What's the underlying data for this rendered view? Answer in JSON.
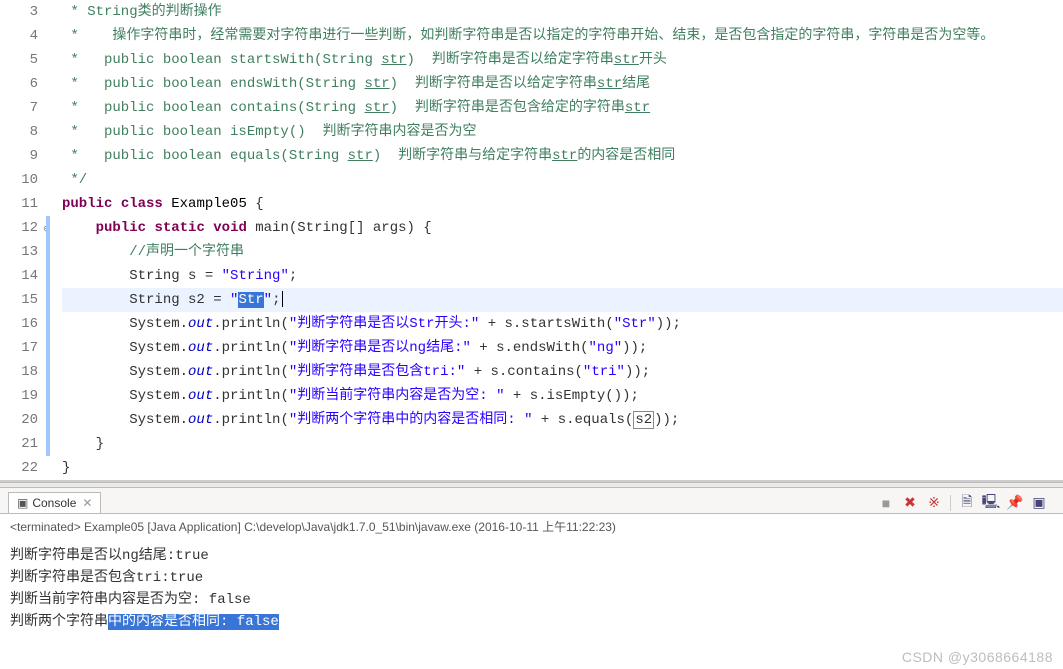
{
  "editor": {
    "lines": [
      {
        "n": 3,
        "html": "<span class='c-comment'> * String类的判断操作</span>"
      },
      {
        "n": 4,
        "html": "<span class='c-comment'> *    操作字符串时，经常需要对字符串进行一些判断，如判断字符串是否以指定的字符串开始、结束，是否包含指定的字符串，字符串是否为空等。</span>"
      },
      {
        "n": 5,
        "html": "<span class='c-comment'> *   public boolean startsWith(String </span><span class='c-underline'>str</span><span class='c-comment'>)  判断字符串是否以给定字符串</span><span class='c-underline'>str</span><span class='c-comment'>开头</span>"
      },
      {
        "n": 6,
        "html": "<span class='c-comment'> *   public boolean endsWith(String </span><span class='c-underline'>str</span><span class='c-comment'>)  判断字符串是否以给定字符串</span><span class='c-underline'>str</span><span class='c-comment'>结尾</span>"
      },
      {
        "n": 7,
        "html": "<span class='c-comment'> *   public boolean contains(String </span><span class='c-underline'>str</span><span class='c-comment'>)  判断字符串是否包含给定的字符串</span><span class='c-underline'>str</span>"
      },
      {
        "n": 8,
        "html": "<span class='c-comment'> *   public boolean isEmpty()  判断字符串内容是否为空</span>"
      },
      {
        "n": 9,
        "html": "<span class='c-comment'> *   public boolean equals(String </span><span class='c-underline'>str</span><span class='c-comment'>)  判断字符串与给定字符串</span><span class='c-underline'>str</span><span class='c-comment'>的内容是否相同</span>"
      },
      {
        "n": 10,
        "html": "<span class='c-comment'> */</span>"
      },
      {
        "n": 11,
        "html": "<span class='c-keyword'>public</span> <span class='c-keyword'>class</span> <span class='c-type'>Example05</span> {"
      },
      {
        "n": 12,
        "html": "    <span class='c-keyword'>public</span> <span class='c-keyword'>static</span> <span class='c-keyword'>void</span> main(String[] args) {",
        "mark": true,
        "bar": true
      },
      {
        "n": 13,
        "html": "        <span class='c-comment'>//声明一个字符串</span>",
        "bar": true
      },
      {
        "n": 14,
        "html": "        String s = <span class='c-string'>\"String\"</span>;",
        "bar": true
      },
      {
        "n": 15,
        "html": "        String s2 = <span class='c-string'>\"</span><span class='sel'><span class='c-string'>Str</span></span><span class='c-string'>\"</span>;<span class='caret' data-name='text-caret' data-interactable='false'></span>",
        "current": true,
        "bar": true
      },
      {
        "n": 16,
        "html": "        System.<span class='c-field'>out</span>.println(<span class='c-string'>\"判断字符串是否以Str开头:\"</span> + s.startsWith(<span class='c-string'>\"Str\"</span>));",
        "bar": true
      },
      {
        "n": 17,
        "html": "        System.<span class='c-field'>out</span>.println(<span class='c-string'>\"判断字符串是否以ng结尾:\"</span> + s.endsWith(<span class='c-string'>\"ng\"</span>));",
        "bar": true
      },
      {
        "n": 18,
        "html": "        System.<span class='c-field'>out</span>.println(<span class='c-string'>\"判断字符串是否包含tri:\"</span> + s.contains(<span class='c-string'>\"tri\"</span>));",
        "bar": true
      },
      {
        "n": 19,
        "html": "        System.<span class='c-field'>out</span>.println(<span class='c-string'>\"判断当前字符串内容是否为空: \"</span> + s.isEmpty());",
        "bar": true
      },
      {
        "n": 20,
        "html": "        System.<span class='c-field'>out</span>.println(<span class='c-string'>\"判断两个字符串中的内容是否相同: \"</span> + s.equals(<span class='c-box'>s2</span>));",
        "bar": true
      },
      {
        "n": 21,
        "html": "    }",
        "bar": true
      },
      {
        "n": 22,
        "html": "}"
      }
    ]
  },
  "console": {
    "tab_label": "Console",
    "terminated": "<terminated> Example05 [Java Application] C:\\develop\\Java\\jdk1.7.0_51\\bin\\javaw.exe (2016-10-11 上午11:22:23)",
    "output": [
      {
        "text": "判断字符串是否以ng结尾:true"
      },
      {
        "text": "判断字符串是否包含tri:true"
      },
      {
        "text": "判断当前字符串内容是否为空: false"
      },
      {
        "pre": "判断两个字符串",
        "hl": "中的内容是否相同: false"
      }
    ],
    "toolbar": {
      "terminate": "■",
      "remove_all": "✖",
      "remove_launch": "※",
      "scroll_lock": "🗎",
      "clear": "🖳",
      "pin": "📌",
      "display": "▣"
    }
  },
  "watermark": "CSDN @y3068664188"
}
